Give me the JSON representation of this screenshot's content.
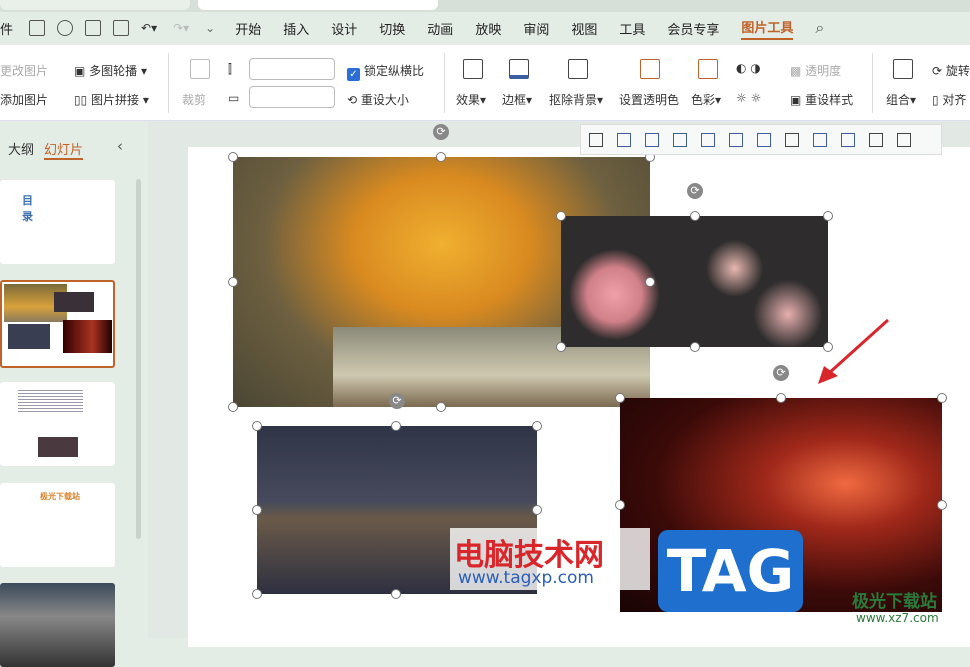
{
  "menu": {
    "file_partial": "件",
    "items": [
      "开始",
      "插入",
      "设计",
      "切换",
      "动画",
      "放映",
      "审阅",
      "视图",
      "工具",
      "会员专享",
      "图片工具"
    ],
    "active": "图片工具",
    "accent": "#c0632a"
  },
  "ribbon": {
    "change_picture": "更改图片",
    "carousel": "多图轮播",
    "add_picture": "添加图片",
    "collage": "图片拼接",
    "crop": "裁剪",
    "height_value": "",
    "width_value": "",
    "lock_ratio": "锁定纵横比",
    "lock_ratio_checked": true,
    "reset_size": "重设大小",
    "effects": "效果",
    "border": "边框",
    "remove_bg": "抠除背景",
    "set_transparent": "设置透明色",
    "color": "色彩",
    "transparency": "透明度",
    "reset_style": "重设样式",
    "group": "组合",
    "rotate": "旋转",
    "align": "对齐"
  },
  "panel": {
    "tabs": [
      "大纲",
      "幻灯片"
    ],
    "active": "幻灯片",
    "thumb1_title": "目 录",
    "thumb4_title": "极光下载站"
  },
  "watermark": {
    "site1": "电脑技术网",
    "url1": "www.tagxp.com",
    "logo": "TAG",
    "site2": "极光下载站",
    "url2": "www.xz7.com"
  },
  "colors": {
    "arrow": "#d9262b",
    "selected_thumb": "#c0632a"
  }
}
